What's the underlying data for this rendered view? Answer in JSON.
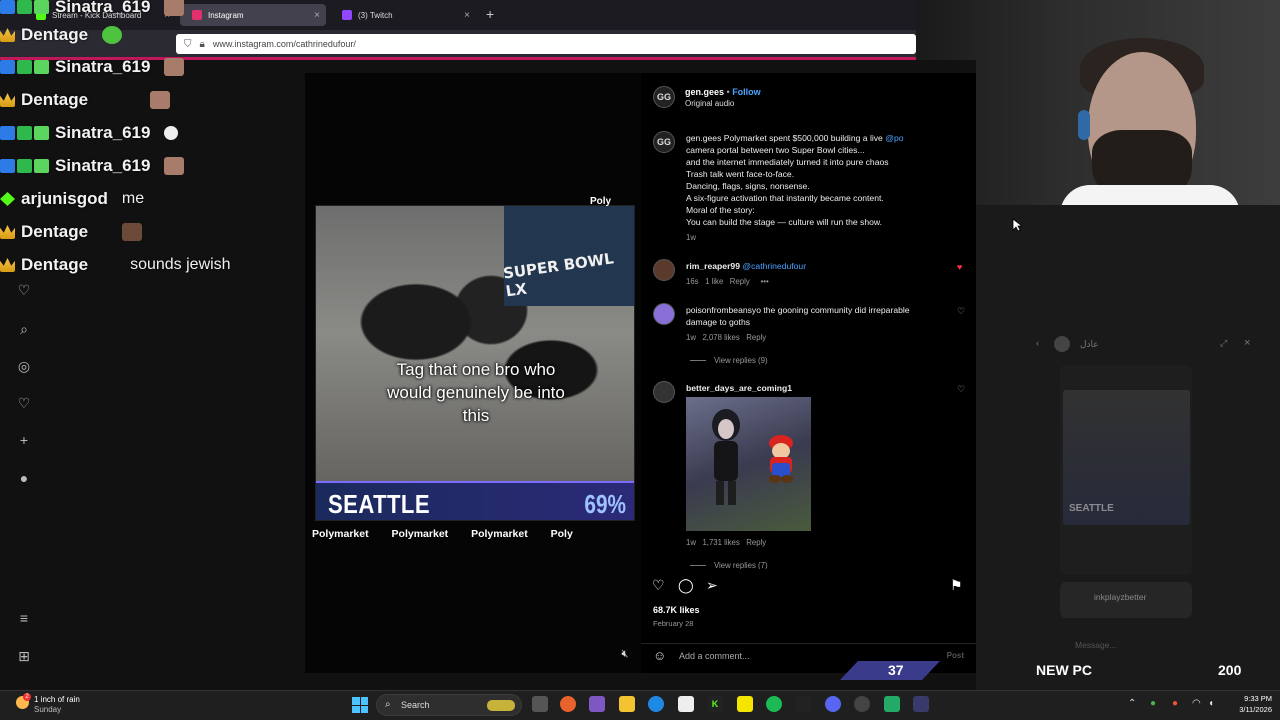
{
  "browser": {
    "tabs": [
      {
        "label": "Stream - Kick Dashboard",
        "favicon_color": "#53fc18",
        "active": false
      },
      {
        "label": "Instagram",
        "favicon_color": "#e1306c",
        "active": true
      },
      {
        "label": "(3) Twitch",
        "favicon_color": "#9146ff",
        "active": false
      }
    ],
    "new_tab": "+",
    "close_glyph": "×",
    "url": "www.instagram.com/cathrinedufour/"
  },
  "post": {
    "author": "gen.gees",
    "follow_label": "Follow",
    "audio": "Original audio",
    "avatar_text": "GG",
    "description_lines": [
      "gen.gees Polymarket spent $500,000 building a live ",
      "camera portal between two Super Bowl cities...",
      "and the internet immediately turned it into pure chaos",
      "Trash talk went face-to-face.",
      "Dancing, flags, signs, nonsense.",
      "A six-figure activation that instantly became content.",
      "Moral of the story:",
      "You can build the stage — culture will run the show."
    ],
    "description_mention": "@po",
    "description_time": "1w",
    "likes": "68.7K likes",
    "date": "February 28",
    "add_comment_placeholder": "Add a comment...",
    "post_label": "Post"
  },
  "comments": [
    {
      "user": "rim_reaper99",
      "mention": "@cathrinedufour",
      "text": "",
      "time": "16s",
      "likes": "1 like",
      "reply": "Reply",
      "more": "•••",
      "liked": true
    },
    {
      "user": "poisonfrombeansyo",
      "mention": "",
      "text_lines": [
        "poisonfrombeansyo the gooning community did irreparable",
        "damage to goths"
      ],
      "time": "1w",
      "likes": "2,078 likes",
      "reply": "Reply",
      "view_replies": "View replies (9)",
      "liked": false
    },
    {
      "user": "better_days_are_coming1",
      "mention": "",
      "text": "",
      "time": "1w",
      "likes": "1,731 likes",
      "reply": "Reply",
      "view_replies": "View replies (7)",
      "liked": false
    }
  ],
  "video": {
    "caption_lines": [
      "Tag that one bro who",
      "would genuinely be into",
      "this"
    ],
    "banner_text": "SUPER BOWL LX",
    "city": "SEATTLE",
    "percent": "69%",
    "corner_tag": "Poly",
    "ticker": [
      "Polymarket",
      "Polymarket",
      "Polymarket",
      "Poly"
    ]
  },
  "dm": {
    "name": "عادل",
    "user": "inkplayzbetter",
    "message_placeholder": "Message...",
    "city": "SEATTLE"
  },
  "chat": [
    {
      "user": "Sinatra_619",
      "badges": [
        "blue",
        "bg",
        "green"
      ],
      "message": "",
      "emote": true
    },
    {
      "user": "Dentage",
      "badges": [
        "crown"
      ],
      "message": "",
      "emote": true
    },
    {
      "user": "Sinatra_619",
      "badges": [
        "blue",
        "bg",
        "green"
      ],
      "message": "",
      "emote": true
    },
    {
      "user": "Dentage",
      "badges": [
        "crown"
      ],
      "message": "",
      "emote": true
    },
    {
      "user": "Sinatra_619",
      "badges": [
        "blue",
        "bg",
        "green"
      ],
      "message": "",
      "emote": true
    },
    {
      "user": "Sinatra_619",
      "badges": [
        "blue",
        "bg",
        "green"
      ],
      "message": "",
      "emote": true
    },
    {
      "user": "arjunisgod",
      "badges": [
        "diamond"
      ],
      "message": "me",
      "emote": false
    },
    {
      "user": "Dentage",
      "badges": [
        "crown"
      ],
      "message": "",
      "emote": true
    },
    {
      "user": "Dentage",
      "badges": [
        "crown"
      ],
      "message": "sounds jewish",
      "emote": false
    }
  ],
  "overlay": {
    "counter": "37",
    "goal_label": "NEW PC",
    "goal_value": "200"
  },
  "taskbar": {
    "weather_line1": "1 inch of rain",
    "weather_line2": "Sunday",
    "weather_badge": "2",
    "search_label": "Search",
    "time": "9:33 PM",
    "date": "3/11/2026"
  },
  "colors": {
    "accent": "#4aa3ff",
    "kick_green": "#53fc18",
    "pink_line": "#c2185b",
    "like_red": "#ff3040"
  }
}
